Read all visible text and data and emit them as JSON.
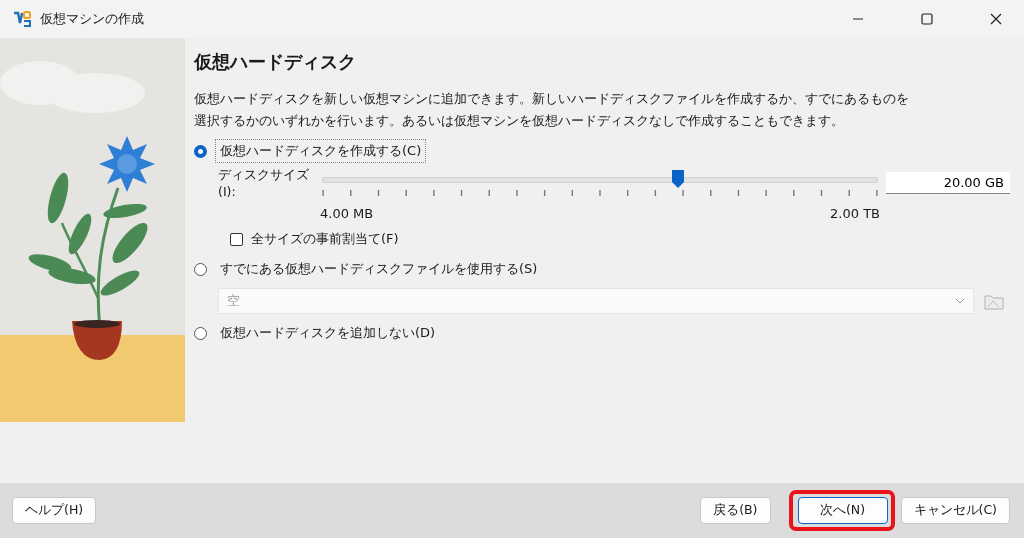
{
  "window": {
    "title": "仮想マシンの作成"
  },
  "page": {
    "heading": "仮想ハードディスク",
    "description": "仮想ハードディスクを新しい仮想マシンに追加できます。新しいハードディスクファイルを作成するか、すでにあるものを選択するかのいずれかを行います。あるいは仮想マシンを仮想ハードディスクなしで作成することもできます。"
  },
  "options": [
    {
      "label": "仮想ハードディスクを作成する(C)",
      "selected": true,
      "focused": true
    },
    {
      "label": "すでにある仮想ハードディスクファイルを使用する(S)",
      "selected": false,
      "focused": false
    },
    {
      "label": "仮想ハードディスクを追加しない(D)",
      "selected": false,
      "focused": false
    }
  ],
  "disk_size": {
    "label": "ディスクサイズ(I):",
    "level": 0.64,
    "value": "20.00 GB",
    "min_label": "4.00 MB",
    "max_label": "2.00 TB"
  },
  "preallocate": {
    "label": "全サイズの事前割当て(F)",
    "checked": false
  },
  "existing_file": {
    "value": "空",
    "disabled": true
  },
  "buttons": [
    {
      "label": "ヘルプ(H)",
      "highlighted": false
    },
    {
      "label": "戻る(B)",
      "highlighted": false
    },
    {
      "label": "次へ(N)",
      "highlighted": true
    },
    {
      "label": "キャンセル(C)",
      "highlighted": false
    }
  ]
}
